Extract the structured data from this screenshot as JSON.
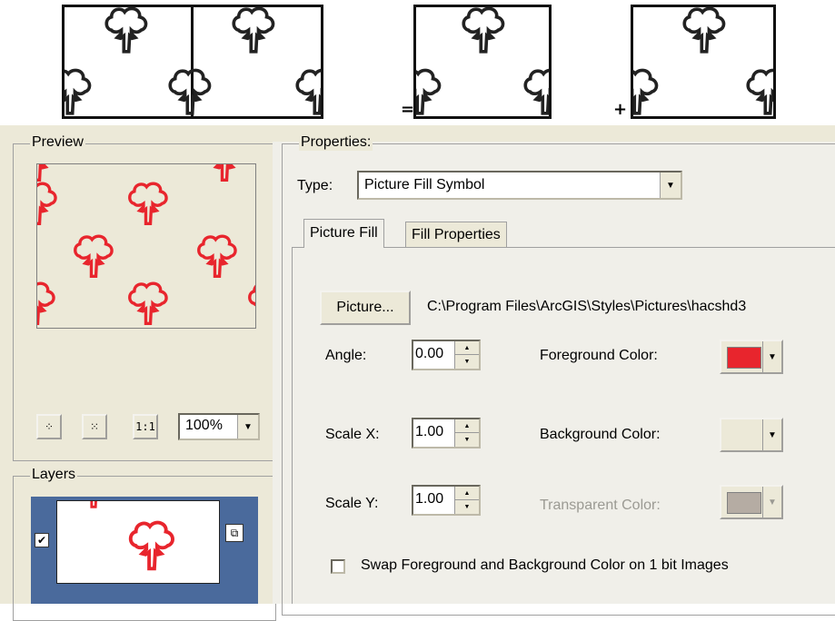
{
  "colors": {
    "tree_dark": "#222222",
    "tree_red": "#e8252d",
    "dialog_bg": "#ece9d8",
    "foreground_swatch": "#e8252d",
    "background_swatch": "#ece9d8",
    "transparent_swatch": "#b5aca3",
    "layer_selection": "#4a6a9c"
  },
  "operators": {
    "equals": "=",
    "plus": "+"
  },
  "preview": {
    "title": "Preview",
    "tools": {
      "zoom_in_icon": "zoom-in-icon",
      "zoom_out_icon": "zoom-out-icon",
      "actual_size_label": "1:1"
    },
    "zoom_value": "100%"
  },
  "layers": {
    "title": "Layers",
    "checked": true,
    "lock_icon": "lock-icon"
  },
  "properties": {
    "title": "Properties:",
    "type_label": "Type:",
    "type_value": "Picture Fill Symbol",
    "tabs": [
      {
        "label": "Picture Fill",
        "active": true
      },
      {
        "label": "Fill Properties",
        "active": false
      }
    ],
    "picture_button": "Picture...",
    "picture_path": "C:\\Program Files\\ArcGIS\\Styles\\Pictures\\hacshd3",
    "angle_label": "Angle:",
    "angle_value": "0.00",
    "scalex_label": "Scale X:",
    "scalex_value": "1.00",
    "scaley_label": "Scale Y:",
    "scaley_value": "1.00",
    "foreground_label": "Foreground Color:",
    "background_label": "Background Color:",
    "transparent_label": "Transparent Color:",
    "swap_label": "Swap Foreground and Background Color on 1 bit Images",
    "swap_checked": false
  }
}
